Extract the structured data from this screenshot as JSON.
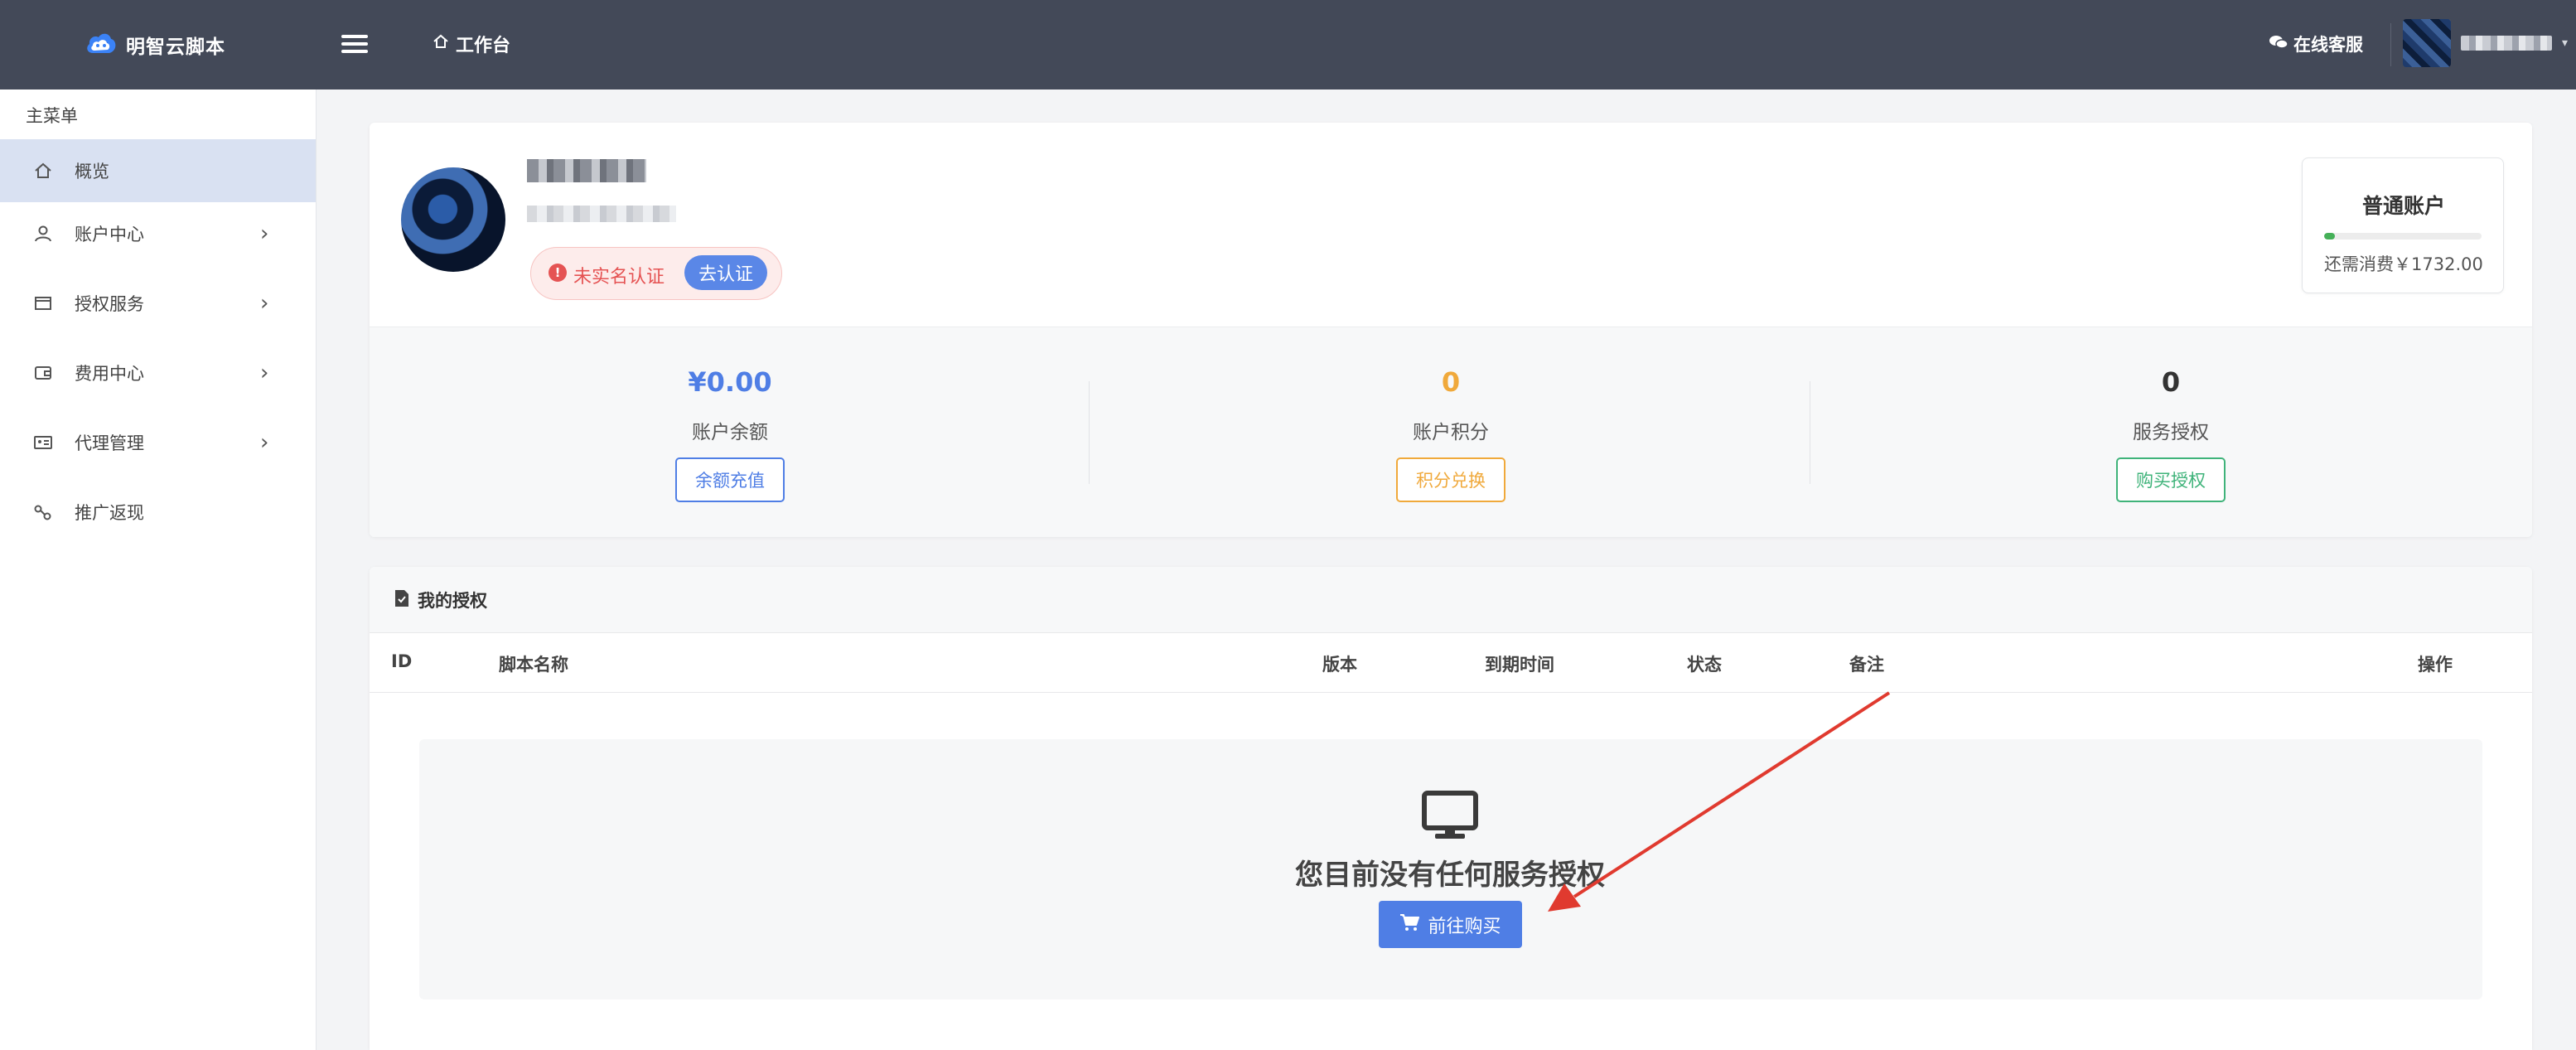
{
  "topbar": {
    "brand": "明智云脚本",
    "crumb": "工作台",
    "service": "在线客服"
  },
  "sidebar": {
    "title": "主菜单",
    "items": [
      {
        "label": "概览",
        "icon": "home-icon",
        "active": true
      },
      {
        "label": "账户中心",
        "icon": "user-icon",
        "arrow": "›"
      },
      {
        "label": "授权服务",
        "icon": "window-icon",
        "arrow": "›"
      },
      {
        "label": "费用中心",
        "icon": "wallet-icon",
        "arrow": "›"
      },
      {
        "label": "代理管理",
        "icon": "id-card-icon",
        "arrow": "›"
      },
      {
        "label": "推广返现",
        "icon": "share-icon"
      }
    ]
  },
  "profile": {
    "verify_status": "未实名认证",
    "verify_button": "去认证",
    "level_title": "普通账户",
    "level_progress": 0.07,
    "level_text": "还需消费￥1732.00"
  },
  "stats": [
    {
      "value": "¥0.00",
      "label": "账户余额",
      "button": "余额充值",
      "color": "#4f7ee5"
    },
    {
      "value": "0",
      "label": "账户积分",
      "button": "积分兑换",
      "color": "#f0a93b"
    },
    {
      "value": "0",
      "label": "服务授权",
      "button": "购买授权",
      "color": "#3fb37a"
    }
  ],
  "authorizations": {
    "title": "我的授权",
    "columns": [
      "ID",
      "脚本名称",
      "版本",
      "到期时间",
      "状态",
      "备注",
      "操作"
    ],
    "empty_text": "您目前没有任何服务授权",
    "buy_button": "前往购买"
  },
  "colors": {
    "topbar": "#434958",
    "accent": "#4f7ee5",
    "danger": "#e55353",
    "arrow": "#e03a2f"
  }
}
